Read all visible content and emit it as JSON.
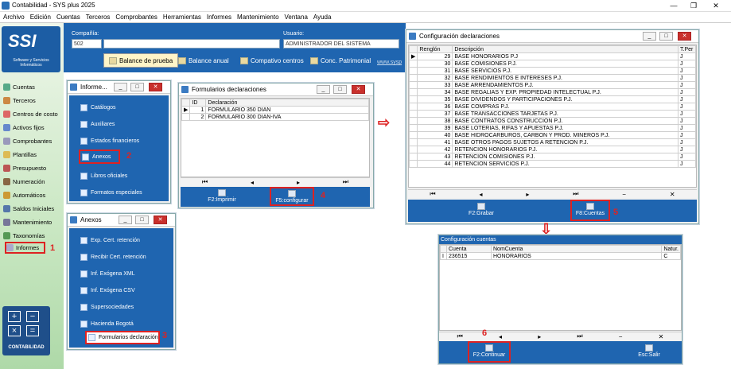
{
  "window": {
    "title": "Contabilidad - SYS plus 2025",
    "min": "—",
    "restore": "❐",
    "close": "✕"
  },
  "menu": [
    "Archivo",
    "Edición",
    "Cuentas",
    "Terceros",
    "Comprobantes",
    "Herramientas",
    "Informes",
    "Mantenimiento",
    "Ventana",
    "Ayuda"
  ],
  "logo": {
    "text": "SSI",
    "sub": "Software y Servicios Informáticos"
  },
  "header": {
    "compania_label": "Compañía:",
    "compania_value": "502",
    "usuario_label": "Usuario:",
    "usuario_value": "ADMINISTRADOR DEL SISTEMA",
    "buttons": [
      "Balance de prueba",
      "Balance anual",
      "Compativo centros",
      "Conc. Patrimonial"
    ],
    "link": "www.sysp"
  },
  "sidebar": [
    "Cuentas",
    "Terceros",
    "Centros de costo",
    "Activos fijos",
    "Comprobantes",
    "Plantillas",
    "Presupuesto",
    "Numeración",
    "Automáticos",
    "Saldos Iniciales",
    "Mantenimiento",
    "Taxonomías",
    "Informes"
  ],
  "sidebar_footer": "CONTABILIDAD",
  "informes": {
    "title": "Informe...",
    "items": [
      "Catálogos",
      "Auxiliares",
      "Estados financieros",
      "Anexos",
      "Libros oficiales",
      "Formatos especiales"
    ]
  },
  "anexos": {
    "title": "Anexos",
    "items": [
      "Exp. Cert. retención",
      "Recibir Cert. retención",
      "Inf. Exógena XML",
      "Inf. Exógena CSV",
      "Supersociedades",
      "Hacienda Bogotá",
      "Formularios declaración"
    ]
  },
  "formularios": {
    "title": "Formularios declaraciones",
    "cols": [
      "ID",
      "Declaración"
    ],
    "rows": [
      [
        "1",
        "FORMULARIO 350 DIAN"
      ],
      [
        "2",
        "FORMULARIO 300 DIAN-IVA"
      ]
    ],
    "btn_print": "F2:Imprimir",
    "btn_config": "F5:configurar"
  },
  "config": {
    "title": "Configuración declaraciones",
    "cols": [
      "Renglón",
      "Descripción",
      "T.Per"
    ],
    "rows": [
      [
        "29",
        "BASE HONORARIOS P.J",
        "J"
      ],
      [
        "30",
        "BASE COMISIONES P.J.",
        "J"
      ],
      [
        "31",
        "BASE SERVICIOS P.J.",
        "J"
      ],
      [
        "32",
        "BASE RENDIMIENTOS E INTERESES P.J.",
        "J"
      ],
      [
        "33",
        "BASE ARRENDAMIENTOS P.J.",
        "J"
      ],
      [
        "34",
        "BASE REGALIAS Y EXP. PROPIEDAD INTELECTUAL P.J.",
        "J"
      ],
      [
        "35",
        "BASE DIVIDENDOS Y PARTICIPACIONES P.J.",
        "J"
      ],
      [
        "36",
        "BASE COMPRAS P.J.",
        "J"
      ],
      [
        "37",
        "BASE TRANSACCIONES TARJETAS P.J.",
        "J"
      ],
      [
        "38",
        "BASE CONTRATOS CONSTRUCCION P.J.",
        "J"
      ],
      [
        "39",
        "BASE LOTERIAS, RIFAS Y APUESTAS P.J.",
        "J"
      ],
      [
        "40",
        "BASE HIDROCARBUROS, CARBON Y PROD. MINEROS P.J.",
        "J"
      ],
      [
        "41",
        "BASE OTROS PAGOS SUJETOS A RETENCION P.J.",
        "J"
      ],
      [
        "42",
        "RETENCION HONORARIOS P.J.",
        "J"
      ],
      [
        "43",
        "RETENCION COMISIONES P.J.",
        "J"
      ],
      [
        "44",
        "RETENCION SERVICIOS P.J.",
        "J"
      ]
    ],
    "btn_grabar": "F2:Grabar",
    "btn_cuentas": "F8:Cuentas"
  },
  "cuentas": {
    "title": "Configuración cuentas",
    "cols": [
      "Cuenta",
      "NomCuenta",
      "Natur."
    ],
    "rows": [
      [
        "236515",
        "HONORARIOS",
        "C"
      ]
    ],
    "btn_continuar": "F2:Continuar",
    "btn_salir": "Esc:Salir"
  },
  "steps": [
    "1",
    "2",
    "3",
    "4",
    "5",
    "6"
  ],
  "colors": {
    "accent_blue": "#1f65b0",
    "highlight_red": "#dd2222"
  }
}
